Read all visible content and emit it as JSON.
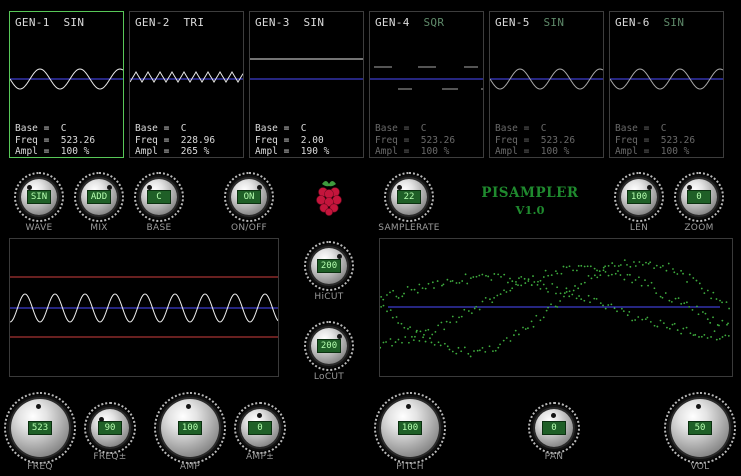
{
  "generators": [
    {
      "id": "GEN-1",
      "wave": "SIN",
      "base": "C",
      "freq": "523.26",
      "ampl": "100 %",
      "selected": true,
      "active": true
    },
    {
      "id": "GEN-2",
      "wave": "TRI",
      "base": "C",
      "freq": "228.96",
      "ampl": "265 %",
      "selected": false,
      "active": true
    },
    {
      "id": "GEN-3",
      "wave": "SIN",
      "base": "C",
      "freq": "2.00",
      "ampl": "190 %",
      "selected": false,
      "active": true
    },
    {
      "id": "GEN-4",
      "wave": "SQR",
      "base": "C",
      "freq": "523.26",
      "ampl": "100 %",
      "selected": false,
      "active": false
    },
    {
      "id": "GEN-5",
      "wave": "SIN",
      "base": "C",
      "freq": "523.26",
      "ampl": "100 %",
      "selected": false,
      "active": false
    },
    {
      "id": "GEN-6",
      "wave": "SIN",
      "base": "C",
      "freq": "523.26",
      "ampl": "100 %",
      "selected": false,
      "active": false
    }
  ],
  "param_labels": {
    "base": "Base =",
    "freq": "Freq =",
    "ampl": "Ampl ="
  },
  "knobs": {
    "wave": {
      "label": "WAVE",
      "value": "SIN"
    },
    "mix": {
      "label": "MIX",
      "value": "ADD"
    },
    "base": {
      "label": "BASE",
      "value": "C"
    },
    "onoff": {
      "label": "ON/OFF",
      "value": "ON"
    },
    "samplerate": {
      "label": "SAMPLERATE",
      "value": "22"
    },
    "len": {
      "label": "LEN",
      "value": "100"
    },
    "zoom": {
      "label": "ZOOM",
      "value": "0"
    },
    "hicut": {
      "label": "HiCUT",
      "value": "200"
    },
    "locut": {
      "label": "LoCUT",
      "value": "200"
    },
    "freq": {
      "label": "FREQ",
      "value": "523"
    },
    "freqfine": {
      "label": "FREQ±",
      "value": "90"
    },
    "amp": {
      "label": "AMP",
      "value": "100"
    },
    "ampfine": {
      "label": "AMP±",
      "value": "0"
    },
    "pitch": {
      "label": "PITCH",
      "value": "100"
    },
    "pan": {
      "label": "PAN",
      "value": "0"
    },
    "vol": {
      "label": "VOL",
      "value": "50"
    }
  },
  "brand": {
    "line1": "PISAMPLER",
    "line2": "V1.0"
  },
  "icons": {
    "logo": "raspberry-pi-icon"
  },
  "colors": {
    "accent": "#58c858",
    "brand": "#1f8a2e",
    "lcd_bg": "#1f5f27",
    "lcd_text": "#b6ffb0",
    "trace": "#ffffff",
    "center_line": "#4c4cff",
    "limit_line": "#d04040",
    "scatter": "#3fae3f"
  }
}
